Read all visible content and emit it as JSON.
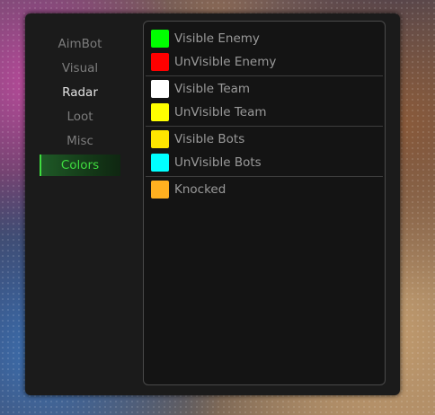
{
  "sidebar": {
    "items": [
      {
        "label": "AimBot"
      },
      {
        "label": "Visual"
      },
      {
        "label": "Radar"
      },
      {
        "label": "Loot"
      },
      {
        "label": "Misc"
      },
      {
        "label": "Colors"
      }
    ],
    "active_index": 5
  },
  "colors_panel": {
    "rows": [
      {
        "label": "Visible Enemy",
        "color": "#00ff00"
      },
      {
        "label": "UnVisible Enemy",
        "color": "#ff0000"
      },
      {
        "label": "Visible Team",
        "color": "#ffffff"
      },
      {
        "label": "UnVisible Team",
        "color": "#ffff00"
      },
      {
        "label": "Visible Bots",
        "color": "#ffe600"
      },
      {
        "label": "UnVisible Bots",
        "color": "#00ffff"
      },
      {
        "label": "Knocked",
        "color": "#ffb020"
      }
    ]
  },
  "theme": {
    "accent": "#3fdc3f",
    "window_bg": "#1b1b1b",
    "panel_bg": "#141414"
  }
}
